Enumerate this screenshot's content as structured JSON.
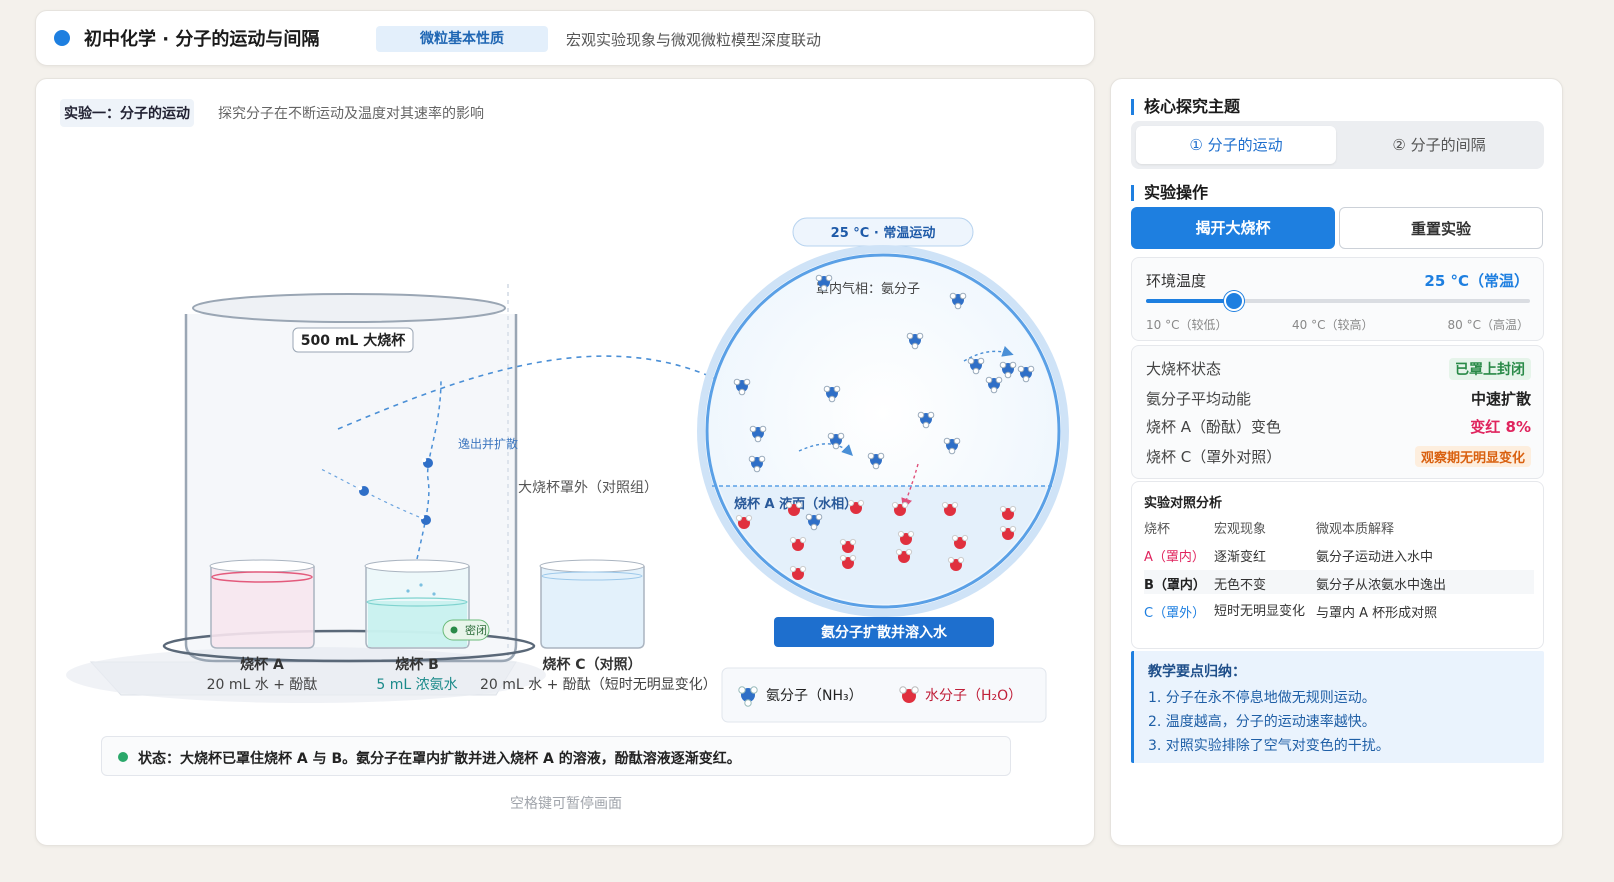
{
  "header": {
    "title": "初中化学 · 分子的运动与间隔",
    "badge": "微粒基本性质",
    "description": "宏观实验现象与微观微粒模型深度联动"
  },
  "experiment": {
    "tag": "实验一：分子的运动",
    "description": "探究分子在不断运动及温度对其速率的影响",
    "big_beaker_label": "500 mL 大烧杯",
    "escape_label": "逸出并扩散",
    "outside_label": "大烧杯罩外（对照组）",
    "sealed_label": "密闭",
    "beakers": [
      {
        "name": "烧杯 A",
        "content": "20 mL 水 + 酚酞"
      },
      {
        "name": "烧杯 B",
        "content": "5 mL 浓氨水"
      },
      {
        "name": "烧杯 C（对照）",
        "content": "20 mL 水 + 酚酞（短时无明显变化）"
      }
    ],
    "micro": {
      "temp_badge": "25 °C · 常温运动",
      "gas_label": "罩内气相：氨分子",
      "liquid_label": "烧杯 A 液面（水相）",
      "caption": "氨分子扩散并溶入水"
    },
    "legend": {
      "ammonia": "氨分子（NH₃）",
      "water": "水分子（H₂O）"
    },
    "status": "状态：大烧杯已罩住烧杯 A 与 B。氨分子在罩内扩散并进入烧杯 A 的溶液，酚酞溶液逐渐变红。",
    "hint": "空格键可暂停画面"
  },
  "panel": {
    "topic_title": "核心探究主题",
    "tabs": [
      "① 分子的运动",
      "② 分子的间隔"
    ],
    "ops_title": "实验操作",
    "btn_primary": "揭开大烧杯",
    "btn_secondary": "重置实验",
    "temp_label": "环境温度",
    "temp_value": "25 °C（常温）",
    "temp_fraction": 0.23,
    "temp_ticks": [
      "10 °C（较低）",
      "40 °C（较高）",
      "80 °C（高温）"
    ],
    "stats": [
      {
        "k": "大烧杯状态",
        "v": "已罩上封闭"
      },
      {
        "k": "氨分子平均动能",
        "v": "中速扩散"
      },
      {
        "k": "烧杯 A（酚酞）变色",
        "v": "变红 8%"
      },
      {
        "k": "烧杯 C（罩外对照）",
        "v": "观察期无明显变化"
      }
    ],
    "table_title": "实验对照分析",
    "table_headers": [
      "烧杯",
      "宏观现象",
      "微观本质解释"
    ],
    "table_rows": [
      [
        "A（罩内）",
        "逐渐变红",
        "氨分子运动进入水中"
      ],
      [
        "B（罩内）",
        "无色不变",
        "氨分子从浓氨水中逸出"
      ],
      [
        "C（罩外）",
        "短时无明显变化",
        "与罩内 A 杯形成对照"
      ]
    ],
    "notes_title": "教学要点归纳：",
    "notes": [
      "1. 分子在永不停息地做无规则运动。",
      "2. 温度越高，分子的运动速率越快。",
      "3. 对照实验排除了空气对变色的干扰。"
    ],
    "colors": {
      "accent": "#1e7fe0",
      "red": "#e0245e",
      "green": "#2a8a48",
      "orange": "#d9600f"
    }
  }
}
